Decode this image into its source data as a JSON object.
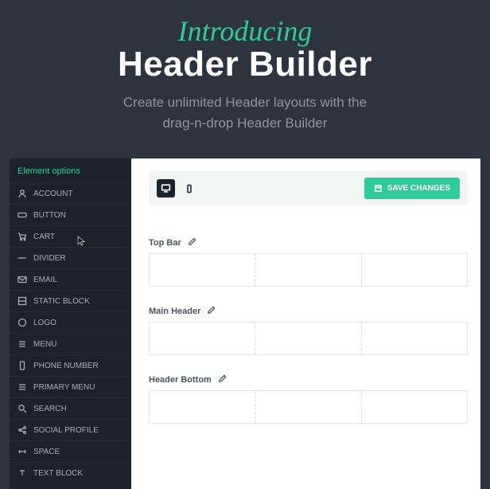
{
  "hero": {
    "intro": "Introducing",
    "title": "Header Builder",
    "subtitle_l1": "Create unlimited Header layouts with the",
    "subtitle_l2": "drag-n-drop Header Builder"
  },
  "sidebar": {
    "heading": "Element options",
    "items": [
      {
        "label": "ACCOUNT",
        "icon": "user"
      },
      {
        "label": "BUTTON",
        "icon": "button"
      },
      {
        "label": "CART",
        "icon": "cart"
      },
      {
        "label": "DIVIDER",
        "icon": "divider"
      },
      {
        "label": "EMAIL",
        "icon": "mail"
      },
      {
        "label": "STATIC BLOCK",
        "icon": "block"
      },
      {
        "label": "LOGO",
        "icon": "logo"
      },
      {
        "label": "MENU",
        "icon": "menu"
      },
      {
        "label": "PHONE NUMBER",
        "icon": "phone"
      },
      {
        "label": "PRIMARY MENU",
        "icon": "menu"
      },
      {
        "label": "SEARCH",
        "icon": "search"
      },
      {
        "label": "SOCIAL PROFILE",
        "icon": "share"
      },
      {
        "label": "SPACE",
        "icon": "space"
      },
      {
        "label": "TEXT BLOCK",
        "icon": "text"
      }
    ]
  },
  "toolbar": {
    "save_label": "SAVE CHANGES"
  },
  "sections": [
    {
      "label": "Top Bar"
    },
    {
      "label": "Main Header"
    },
    {
      "label": "Header Bottom"
    }
  ]
}
